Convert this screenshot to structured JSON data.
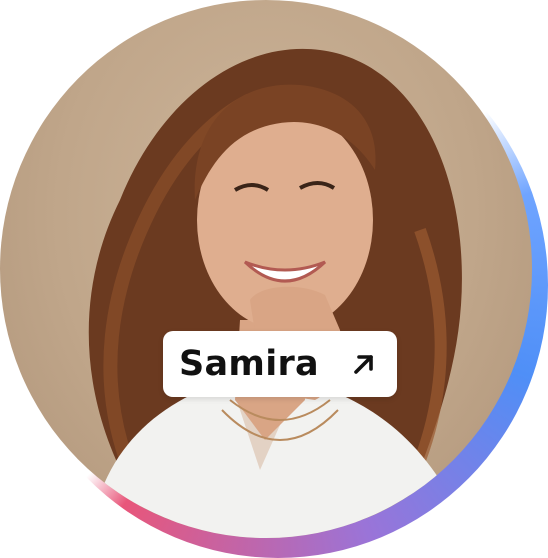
{
  "profile": {
    "name": "Samira",
    "arrow_icon": "arrow-up-right-icon",
    "ring_colors": [
      "#4f8ff7",
      "#9a74d8",
      "#e8567a"
    ],
    "background_color": "#c3a98d"
  }
}
